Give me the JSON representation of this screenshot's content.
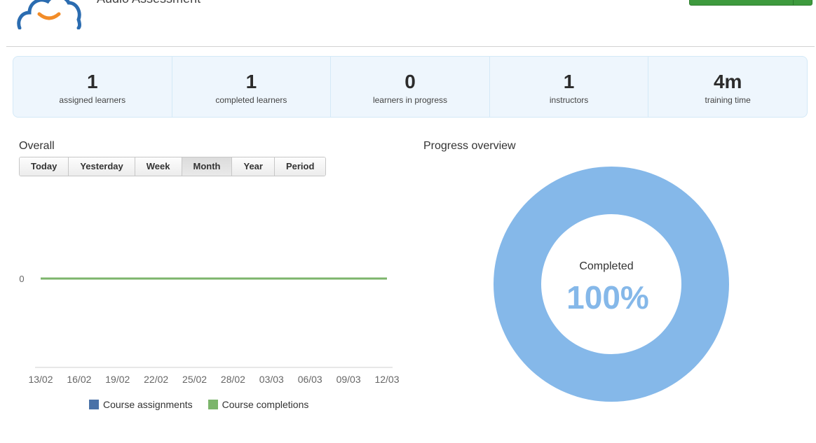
{
  "header": {
    "course_title": "Audio Assessment",
    "accent_color": "#3e9a3e"
  },
  "stats": [
    {
      "value": "1",
      "label": "assigned learners"
    },
    {
      "value": "1",
      "label": "completed learners"
    },
    {
      "value": "0",
      "label": "learners in progress"
    },
    {
      "value": "1",
      "label": "instructors"
    },
    {
      "value": "4m",
      "label": "training time"
    }
  ],
  "overall": {
    "title": "Overall",
    "filters": [
      "Today",
      "Yesterday",
      "Week",
      "Month",
      "Year",
      "Period"
    ],
    "active_filter": "Month"
  },
  "progress": {
    "title": "Progress overview",
    "center_label": "Completed",
    "center_value": "100%",
    "ring_color": "#85b8e9"
  },
  "chart_data": [
    {
      "type": "line",
      "x": [
        "13/02",
        "16/02",
        "19/02",
        "22/02",
        "25/02",
        "28/02",
        "03/03",
        "06/03",
        "09/03",
        "12/03"
      ],
      "y_ticks": [
        "0"
      ],
      "series": [
        {
          "name": "Course assignments",
          "color": "#4a72a8",
          "values": [
            0,
            0,
            0,
            0,
            0,
            0,
            0,
            0,
            0,
            0
          ]
        },
        {
          "name": "Course completions",
          "color": "#7cb56b",
          "values": [
            0,
            0,
            0,
            0,
            0,
            0,
            0,
            0,
            0,
            0
          ]
        }
      ],
      "legend": "bottom"
    },
    {
      "type": "pie",
      "categories": [
        "Completed"
      ],
      "values": [
        100
      ],
      "title": "Progress overview"
    }
  ]
}
